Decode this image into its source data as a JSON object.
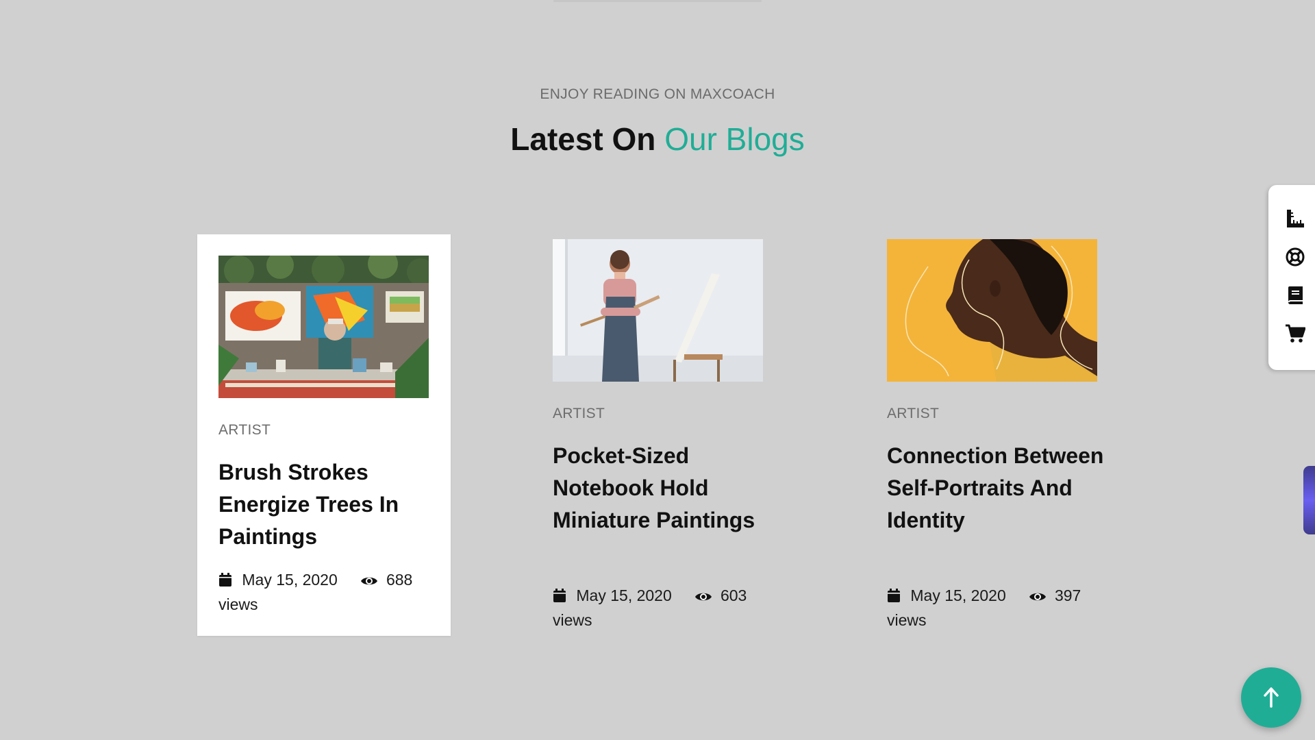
{
  "section": {
    "subtitle": "ENJOY READING ON MAXCOACH",
    "title_strong": "Latest On",
    "title_accent": "Our Blogs"
  },
  "posts": [
    {
      "category": "ARTIST",
      "title": "Brush Strokes Energize Trees In Paintings",
      "date": "May 15, 2020",
      "views_count": "688",
      "views_label": "views"
    },
    {
      "category": "ARTIST",
      "title": "Pocket-Sized Notebook Hold Miniature Paintings",
      "date": "May 15, 2020",
      "views_count": "603",
      "views_label": "views"
    },
    {
      "category": "ARTIST",
      "title": "Connection Between Self-Portraits And Identity",
      "date": "May 15, 2020",
      "views_count": "397",
      "views_label": "views"
    }
  ],
  "side_toolbar": {
    "icons": [
      "ruler-icon",
      "lifebuoy-icon",
      "book-icon",
      "cart-icon"
    ]
  },
  "colors": {
    "accent": "#20ad96",
    "background": "#d0d0d0",
    "card_bg": "#ffffff",
    "thumb_yellow": "#f4b43a"
  }
}
